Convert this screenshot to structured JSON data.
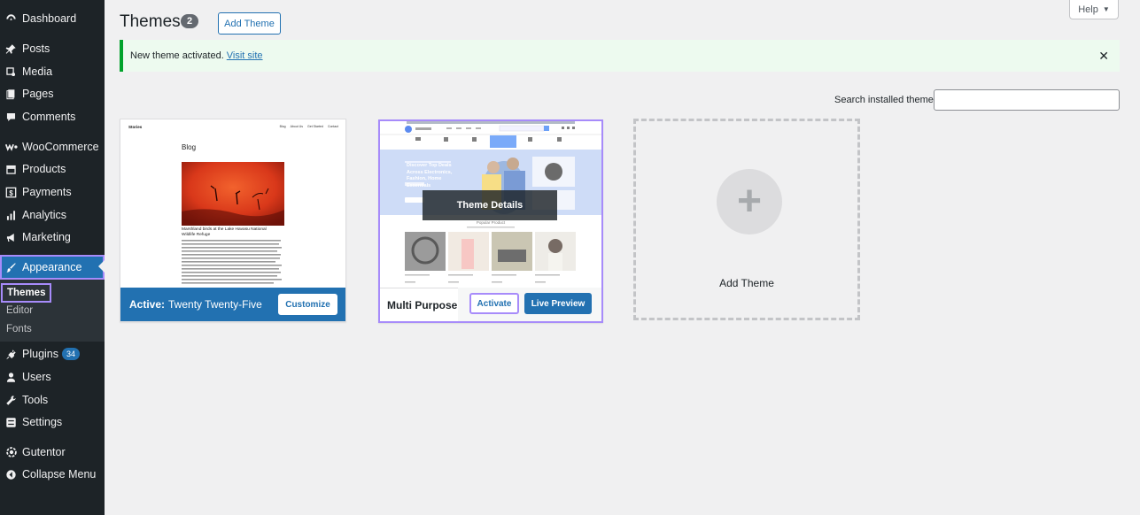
{
  "sidebar": {
    "items": [
      {
        "label": "Dashboard",
        "icon": "dashboard-icon"
      },
      {
        "label": "Posts",
        "icon": "pin-icon"
      },
      {
        "label": "Media",
        "icon": "media-icon"
      },
      {
        "label": "Pages",
        "icon": "pages-icon"
      },
      {
        "label": "Comments",
        "icon": "comment-icon"
      },
      {
        "label": "WooCommerce",
        "icon": "woo-icon"
      },
      {
        "label": "Products",
        "icon": "archive-icon"
      },
      {
        "label": "Payments",
        "icon": "dollar-icon"
      },
      {
        "label": "Analytics",
        "icon": "bar-chart-icon"
      },
      {
        "label": "Marketing",
        "icon": "megaphone-icon"
      },
      {
        "label": "Appearance",
        "icon": "brush-icon"
      },
      {
        "label": "Plugins",
        "icon": "plug-icon",
        "badge": "34"
      },
      {
        "label": "Users",
        "icon": "user-icon"
      },
      {
        "label": "Tools",
        "icon": "wrench-icon"
      },
      {
        "label": "Settings",
        "icon": "settings-icon"
      },
      {
        "label": "Gutentor",
        "icon": "gutentor-icon"
      },
      {
        "label": "Collapse Menu",
        "icon": "collapse-icon"
      }
    ],
    "submenu": [
      "Themes",
      "Editor",
      "Fonts"
    ]
  },
  "header": {
    "title": "Themes",
    "count": "2",
    "add_theme_label": "Add Theme",
    "help_label": "Help"
  },
  "notice": {
    "text": "New theme activated.",
    "link": "Visit site"
  },
  "search": {
    "label": "Search installed themes",
    "value": ""
  },
  "themes": {
    "active": {
      "prefix": "Active:",
      "name": "Twenty Twenty-Five",
      "customize_label": "Customize",
      "preview_header": "Stories",
      "preview_nav": [
        "Blog",
        "About Us",
        "Get Started",
        "Contact"
      ],
      "preview_heading": "Blog",
      "preview_caption": "Marshland birds at the Lake Havasu National Wildlife Refuge"
    },
    "second": {
      "name": "Multi Purpose Bu",
      "activate_label": "Activate",
      "live_preview_label": "Live Preview",
      "details_label": "Theme Details",
      "hero_text": "Discover Top Deals Across Electronics, Fashion, Home Essentials",
      "section_label": "Popular Product"
    },
    "add_new_label": "Add Theme"
  },
  "colors": {
    "sidebar_bg": "#1d2327",
    "accent": "#2271b1",
    "notice_green": "#00a32a",
    "focus_outline": "#a78bfa"
  }
}
